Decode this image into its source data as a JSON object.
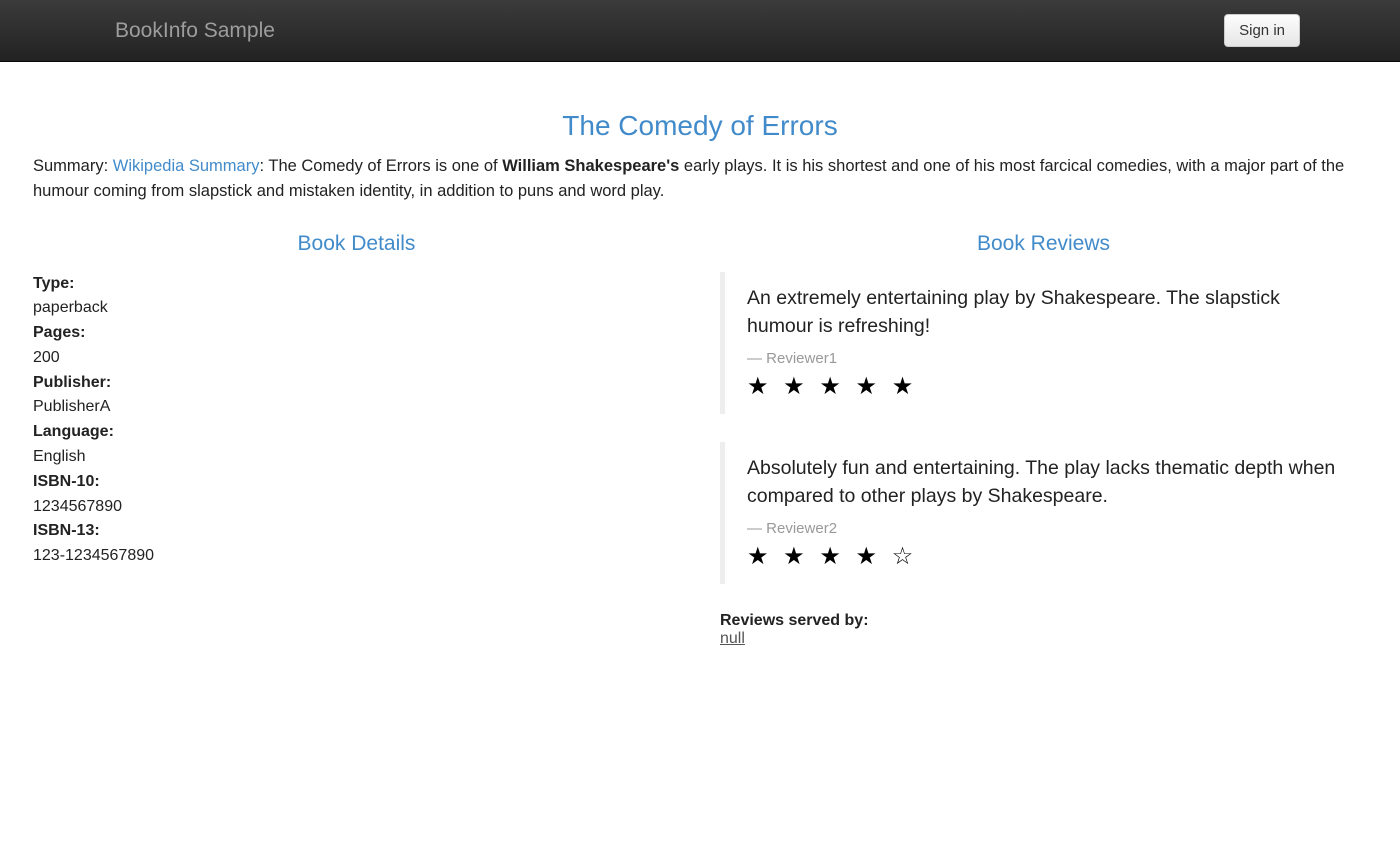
{
  "navbar": {
    "brand": "BookInfo Sample",
    "signin_label": "Sign in"
  },
  "title": "The Comedy of Errors",
  "summary": {
    "prefix": "Summary: ",
    "link_text": "Wikipedia Summary",
    "sep": ": ",
    "pre_bold": "The Comedy of Errors is one of ",
    "bold": "William Shakespeare's",
    "post_bold": " early plays. It is his shortest and one of his most farcical comedies, with a major part of the humour coming from slapstick and mistaken identity, in addition to puns and word play."
  },
  "details": {
    "heading": "Book Details",
    "items": [
      {
        "label": "Type:",
        "value": "paperback"
      },
      {
        "label": "Pages:",
        "value": "200"
      },
      {
        "label": "Publisher:",
        "value": "PublisherA"
      },
      {
        "label": "Language:",
        "value": "English"
      },
      {
        "label": "ISBN-10:",
        "value": "1234567890"
      },
      {
        "label": "ISBN-13:",
        "value": "123-1234567890"
      }
    ]
  },
  "reviews": {
    "heading": "Book Reviews",
    "items": [
      {
        "text": "An extremely entertaining play by Shakespeare. The slapstick humour is refreshing!",
        "reviewer": "Reviewer1",
        "stars": "★ ★ ★ ★ ★"
      },
      {
        "text": "Absolutely fun and entertaining. The play lacks thematic depth when compared to other plays by Shakespeare.",
        "reviewer": "Reviewer2",
        "stars": "★ ★ ★ ★ ☆"
      }
    ],
    "served_label": "Reviews served by:",
    "served_value": "null"
  }
}
